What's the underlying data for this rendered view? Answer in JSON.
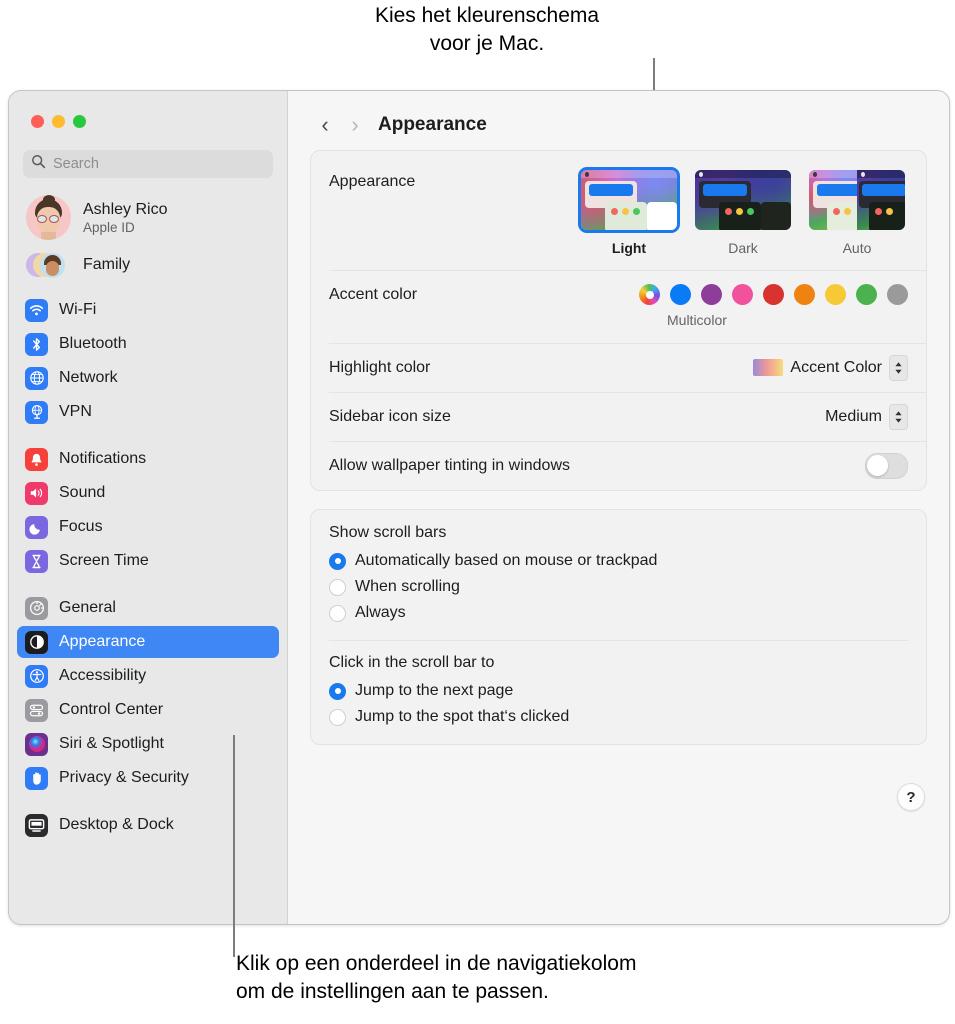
{
  "callouts": {
    "top": "Kies het kleurenschema\nvoor je Mac.",
    "bottom": "Klik op een onderdeel in de navigatiekolom\nom de instellingen aan te passen."
  },
  "window": {
    "traffic_lights": [
      "close",
      "minimize",
      "zoom"
    ]
  },
  "sidebar": {
    "search": {
      "placeholder": "Search",
      "value": ""
    },
    "account": {
      "name": "Ashley Rico",
      "subtitle": "Apple ID"
    },
    "family": {
      "label": "Family"
    },
    "groups": [
      {
        "items": [
          {
            "label": "Wi-Fi",
            "icon": "wifi-icon",
            "color": "#2f7cf6"
          },
          {
            "label": "Bluetooth",
            "icon": "bluetooth-icon",
            "color": "#2f7cf6"
          },
          {
            "label": "Network",
            "icon": "globe-icon",
            "color": "#2f7cf6"
          },
          {
            "label": "VPN",
            "icon": "vpn-icon",
            "color": "#2f7cf6"
          }
        ]
      },
      {
        "items": [
          {
            "label": "Notifications",
            "icon": "bell-icon",
            "color": "#f6413a"
          },
          {
            "label": "Sound",
            "icon": "speaker-icon",
            "color": "#f03a6b"
          },
          {
            "label": "Focus",
            "icon": "moon-icon",
            "color": "#7b68e0"
          },
          {
            "label": "Screen Time",
            "icon": "hourglass-icon",
            "color": "#7b68e0"
          }
        ]
      },
      {
        "items": [
          {
            "label": "General",
            "icon": "gear-icon",
            "color": "#9a9a9f"
          },
          {
            "label": "Appearance",
            "icon": "appearance-icon",
            "color": "#1c1c1e",
            "selected": true
          },
          {
            "label": "Accessibility",
            "icon": "accessibility-icon",
            "color": "#2f7cf6"
          },
          {
            "label": "Control Center",
            "icon": "control-center-icon",
            "color": "#9a9a9f"
          },
          {
            "label": "Siri & Spotlight",
            "icon": "siri-icon",
            "color": "#6b2f8f"
          },
          {
            "label": "Privacy & Security",
            "icon": "hand-icon",
            "color": "#2f7cf6"
          }
        ]
      },
      {
        "items": [
          {
            "label": "Desktop & Dock",
            "icon": "desktop-dock-icon",
            "color": "#2b2b2d"
          }
        ]
      }
    ],
    "selected_accent": "#3f87f5"
  },
  "detail": {
    "title": "Appearance",
    "nav": {
      "back": "‹",
      "forward": "›"
    },
    "appearance": {
      "label": "Appearance",
      "options": [
        {
          "name": "Light",
          "selected": true
        },
        {
          "name": "Dark",
          "selected": false
        },
        {
          "name": "Auto",
          "selected": false
        }
      ]
    },
    "accent_color": {
      "label": "Accent color",
      "caption": "Multicolor",
      "swatches": [
        {
          "name": "Multicolor",
          "color": "multicolor",
          "selected": true
        },
        {
          "name": "Blue",
          "color": "#0a7bf5"
        },
        {
          "name": "Purple",
          "color": "#8e3d9b"
        },
        {
          "name": "Pink",
          "color": "#f0529e"
        },
        {
          "name": "Red",
          "color": "#d8332e"
        },
        {
          "name": "Orange",
          "color": "#ef8312"
        },
        {
          "name": "Yellow",
          "color": "#f6c937"
        },
        {
          "name": "Green",
          "color": "#4cb14f"
        },
        {
          "name": "Graphite",
          "color": "#9a9a9a"
        }
      ]
    },
    "highlight_color": {
      "label": "Highlight color",
      "value": "Accent Color"
    },
    "sidebar_icon_size": {
      "label": "Sidebar icon size",
      "value": "Medium"
    },
    "wallpaper_tinting": {
      "label": "Allow wallpaper tinting in windows",
      "enabled": false
    },
    "show_scroll_bars": {
      "title": "Show scroll bars",
      "options": [
        {
          "label": "Automatically based on mouse or trackpad",
          "selected": true
        },
        {
          "label": "When scrolling",
          "selected": false
        },
        {
          "label": "Always",
          "selected": false
        }
      ]
    },
    "click_scroll_bar": {
      "title": "Click in the scroll bar to",
      "options": [
        {
          "label": "Jump to the next page",
          "selected": true
        },
        {
          "label": "Jump to the spot that‘s clicked",
          "selected": false
        }
      ]
    },
    "help": {
      "label": "?"
    }
  }
}
